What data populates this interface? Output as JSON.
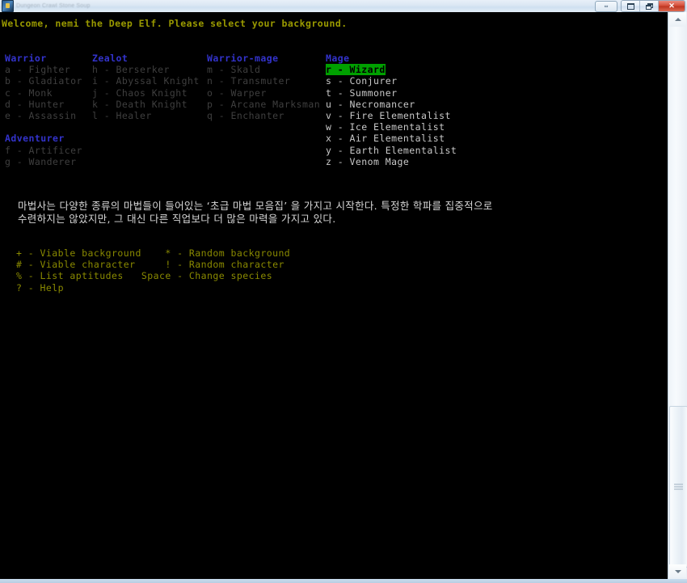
{
  "window": {
    "title": "Dungeon Crawl Stone Soup",
    "icon_name": "crawl-app-icon",
    "buttons": {
      "extra_label": "⇔",
      "minimize_label": "–",
      "restore_label": "",
      "close_label": "✕"
    }
  },
  "terminal": {
    "welcome": "Welcome, nemi the Deep Elf. Please select your background.",
    "columns": [
      {
        "id": "warrior",
        "heading": "Warrior",
        "items": [
          "a - Fighter",
          "b - Gladiator",
          "c - Monk",
          "d - Hunter",
          "e - Assassin"
        ]
      },
      {
        "id": "adventurer",
        "heading": "Adventurer",
        "items": [
          "f - Artificer",
          "g - Wanderer"
        ]
      },
      {
        "id": "zealot",
        "heading": "Zealot",
        "items": [
          "h - Berserker",
          "i - Abyssal Knight",
          "j - Chaos Knight",
          "k - Death Knight",
          "l - Healer"
        ]
      },
      {
        "id": "warrior-mage",
        "heading": "Warrior-mage",
        "items": [
          "m - Skald",
          "n - Transmuter",
          "o - Warper",
          "p - Arcane Marksman",
          "q - Enchanter"
        ]
      },
      {
        "id": "mage",
        "heading": "Mage",
        "items": [
          "r - Wizard",
          "s - Conjurer",
          "t - Summoner",
          "u - Necromancer",
          "v - Fire Elementalist",
          "w - Ice Elementalist",
          "x - Air Elementalist",
          "y - Earth Elementalist",
          "z - Venom Mage"
        ],
        "selected_index": 0
      }
    ],
    "description": "마법사는 다양한 종류의 마법들이 들어있는 ‘초급 마법 모음집’ 을 가지고 시작한다. 특정한 학파를 집중적으로\n수련하지는 않았지만, 그 대신 다른 직업보다 더 많은 마력을 가지고 있다.",
    "help": [
      "+ - Viable background    * - Random background",
      "# - Viable character     ! - Random character",
      "% - List aptitudes   Space - Change species",
      "? - Help"
    ]
  },
  "scrollbar": {
    "up_arrow_name": "scroll-up-arrow",
    "down_arrow_name": "scroll-down-arrow"
  },
  "colors": {
    "background": "#000000",
    "welcome_text": "#9a9a00",
    "heading": "#3333cc",
    "dim_item": "#3f3f3f",
    "bright_item": "#c8c8c8",
    "selection_bg": "#00a000",
    "selection_fg": "#000000",
    "help_text": "#8a8a00",
    "description_text": "#d7d7d7"
  }
}
